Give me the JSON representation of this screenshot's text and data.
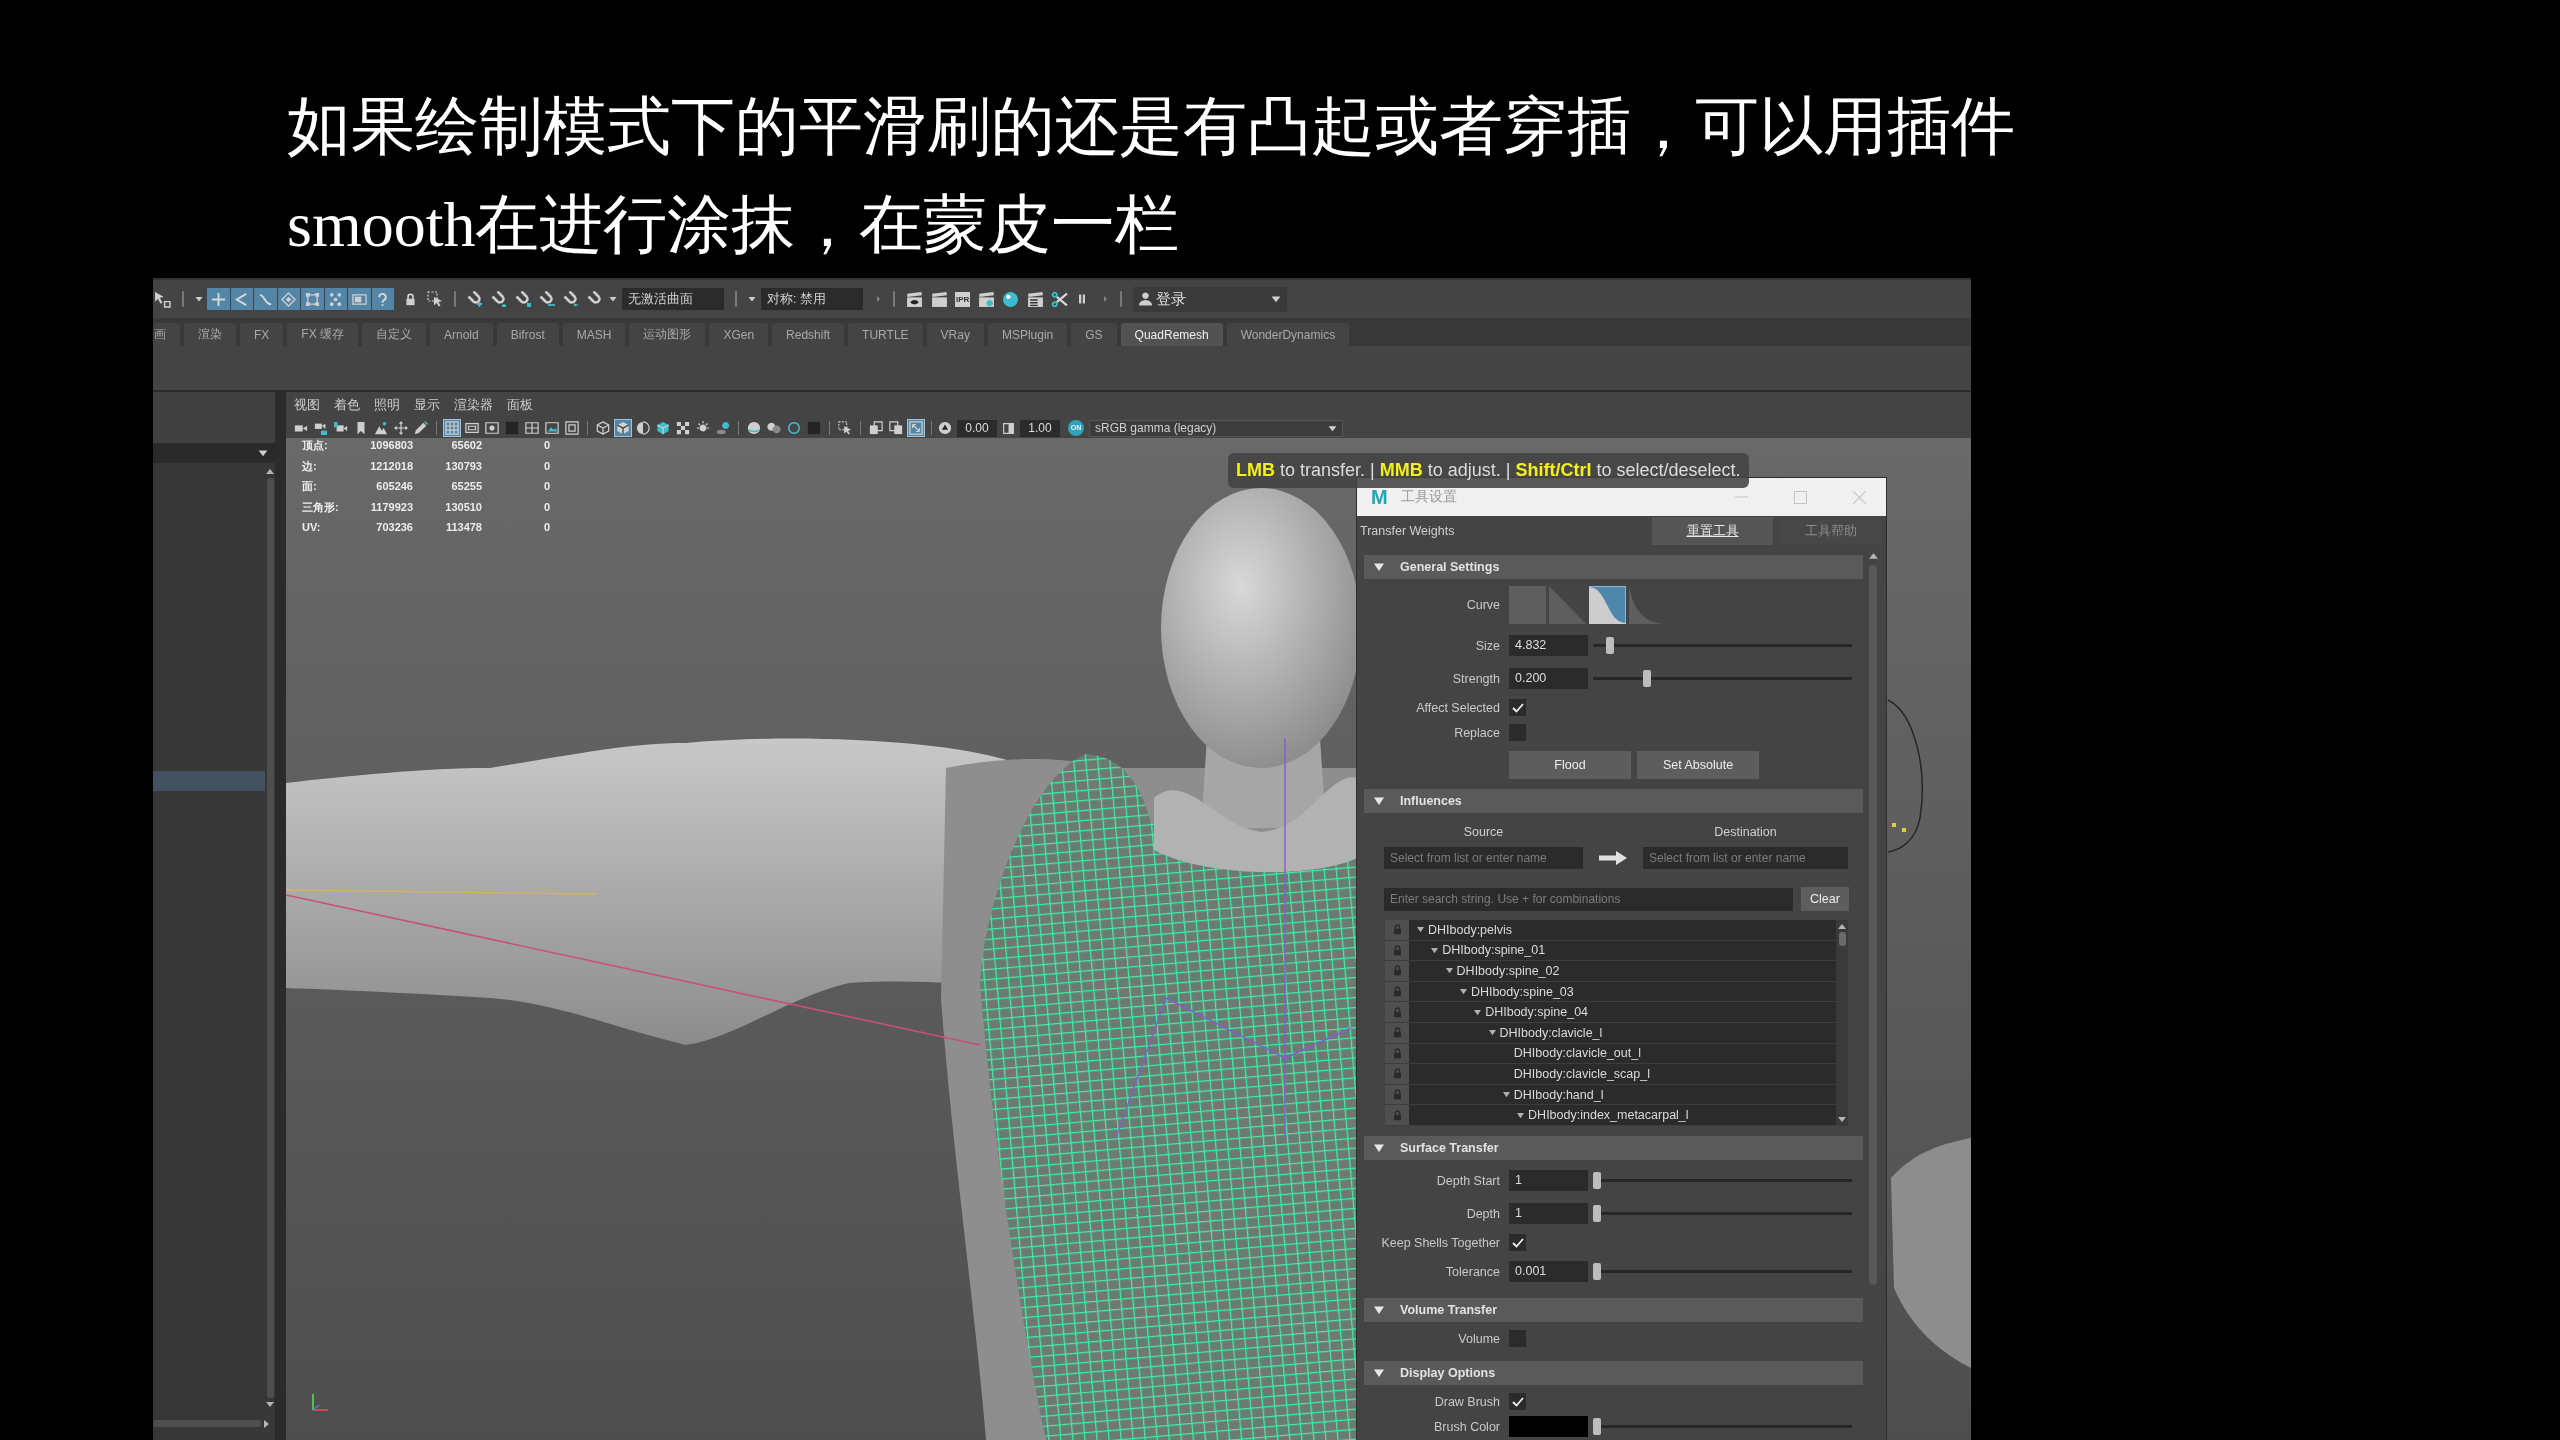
{
  "caption": {
    "lines": [
      "如果绘制模式下的平滑刷的还是有凸起或者穿插，可以用插件",
      "smooth在进行涂抹，在蒙皮一栏"
    ]
  },
  "status_line": {
    "mask_buttons": [
      {
        "on": true
      },
      {
        "on": true
      },
      {
        "on": true
      },
      {
        "on": true
      },
      {
        "on": true
      },
      {
        "on": true
      },
      {
        "on": true
      },
      {
        "on": true
      }
    ],
    "live_surface_field": "无激活曲面",
    "symmetry_field": "对称: 禁用",
    "ipr_label": "IPR",
    "login_label": "登录"
  },
  "shelf_tabs": [
    {
      "label": "画",
      "selected": false
    },
    {
      "label": "渲染",
      "selected": false
    },
    {
      "label": "FX",
      "selected": false
    },
    {
      "label": "FX 缓存",
      "selected": false
    },
    {
      "label": "自定义",
      "selected": false
    },
    {
      "label": "Arnold",
      "selected": false
    },
    {
      "label": "Bifrost",
      "selected": false
    },
    {
      "label": "MASH",
      "selected": false
    },
    {
      "label": "运动图形",
      "selected": false
    },
    {
      "label": "XGen",
      "selected": false
    },
    {
      "label": "Redshift",
      "selected": false
    },
    {
      "label": "TURTLE",
      "selected": false
    },
    {
      "label": "VRay",
      "selected": false
    },
    {
      "label": "MSPlugin",
      "selected": false
    },
    {
      "label": "GS",
      "selected": false
    },
    {
      "label": "QuadRemesh",
      "selected": true
    },
    {
      "label": "WonderDynamics",
      "selected": false
    }
  ],
  "outliner": {
    "rows": [
      {
        "selected": false
      },
      {
        "selected": false
      },
      {
        "selected": false
      },
      {
        "selected": false
      },
      {
        "selected": false
      },
      {
        "selected": false
      },
      {
        "selected": false
      },
      {
        "selected": false
      },
      {
        "selected": false
      },
      {
        "selected": false
      },
      {
        "selected": false
      },
      {
        "selected": false
      },
      {
        "selected": false
      },
      {
        "selected": false
      },
      {
        "selected": false
      },
      {
        "selected": true
      }
    ]
  },
  "viewport": {
    "menu": [
      "视图",
      "着色",
      "照明",
      "显示",
      "渲染器",
      "面板"
    ],
    "view_buttons": [
      {
        "on": false
      },
      {
        "on": false
      },
      {
        "on": false
      },
      {
        "on": false
      },
      {
        "on": false
      },
      {
        "on": false
      },
      {
        "on": false
      },
      {
        "on": true
      },
      {
        "on": false
      },
      {
        "on": false
      },
      {
        "on": false
      },
      {
        "on": false
      },
      {
        "on": false
      },
      {
        "on": false
      },
      {
        "on": false
      },
      {
        "on": true
      },
      {
        "on": false
      },
      {
        "on": false
      },
      {
        "on": false
      },
      {
        "on": false
      },
      {
        "on": false
      },
      {
        "on": false
      },
      {
        "on": false
      },
      {
        "on": false
      },
      {
        "on": false
      },
      {
        "on": false
      },
      {
        "on": false
      },
      {
        "on": false
      },
      {
        "on": true
      }
    ],
    "exposure": "0.00",
    "gamma": "1.00",
    "color_management": {
      "label": "ON",
      "on": true
    },
    "color_space": "sRGB gamma (legacy)",
    "stats": [
      {
        "label": "顶点:",
        "values": [
          "1096803",
          "65602",
          "0"
        ]
      },
      {
        "label": "边:",
        "values": [
          "1212018",
          "130793",
          "0"
        ]
      },
      {
        "label": "面:",
        "values": [
          "605246",
          "65255",
          "0"
        ]
      },
      {
        "label": "三角形:",
        "values": [
          "1179923",
          "130510",
          "0"
        ]
      },
      {
        "label": "UV:",
        "values": [
          "703236",
          "113478",
          "0"
        ]
      }
    ],
    "hint": "**LMB** to transfer. | **MMB** to adjust. | **Shift/Ctrl** to select/deselect."
  },
  "tool_settings": {
    "app_logo": "M",
    "window_title": "工具设置",
    "tool_name": "Transfer Weights",
    "header_buttons": [
      {
        "label": "重置工具",
        "disabled": false
      },
      {
        "label": "工具帮助",
        "disabled": true
      }
    ],
    "sections": [
      {
        "title": "General Settings",
        "expanded": true,
        "rows": [
          {
            "kind": "curve",
            "label": "Curve",
            "presets": [
              {
                "kind": "flat",
                "selected": false
              },
              {
                "kind": "linear",
                "selected": false
              },
              {
                "kind": "smooth",
                "selected": true
              },
              {
                "kind": "falloff",
                "selected": false
              }
            ]
          },
          {
            "kind": "slider",
            "label": "Size",
            "value": "4.832",
            "level": 0.05
          },
          {
            "kind": "slider",
            "label": "Strength",
            "value": "0.200",
            "level": 0.2
          },
          {
            "kind": "checkbox",
            "label": "Affect Selected",
            "checked": true
          },
          {
            "kind": "checkbox",
            "label": "Replace",
            "checked": false
          },
          {
            "kind": "buttons",
            "buttons": [
              "Flood",
              "Set Absolute"
            ]
          }
        ]
      },
      {
        "title": "Influences",
        "expanded": true,
        "rows": [
          {
            "kind": "transfer",
            "source": {
              "label": "Source",
              "placeholder": "Select from list or enter name"
            },
            "destination": {
              "label": "Destination",
              "placeholder": "Select from list or enter name"
            }
          },
          {
            "kind": "search",
            "placeholder": "Enter search string. Use + for combinations",
            "button": "Clear"
          },
          {
            "kind": "tree",
            "items": [
              {
                "label": "DHIbody:pelvis",
                "expanded": true,
                "children": [
                  {
                    "label": "DHIbody:spine_01",
                    "expanded": true,
                    "children": [
                      {
                        "label": "DHIbody:spine_02",
                        "expanded": true,
                        "children": [
                          {
                            "label": "DHIbody:spine_03",
                            "expanded": true,
                            "children": [
                              {
                                "label": "DHIbody:spine_04",
                                "expanded": true,
                                "children": [
                                  {
                                    "label": "DHIbody:clavicle_l",
                                    "expanded": true,
                                    "children": [
                                      {
                                        "label": "DHIbody:clavicle_out_l"
                                      },
                                      {
                                        "label": "DHIbody:clavicle_scap_l"
                                      },
                                      {
                                        "label": "DHIbody:hand_l",
                                        "expanded": true,
                                        "children": [
                                          {
                                            "label": "DHIbody:index_metacarpal_l",
                                            "expanded": true
                                          }
                                        ]
                                      }
                                    ]
                                  }
                                ]
                              }
                            ]
                          }
                        ]
                      }
                    ]
                  }
                ]
              }
            ]
          }
        ]
      },
      {
        "title": "Surface Transfer",
        "expanded": true,
        "rows": [
          {
            "kind": "slider",
            "label": "Depth Start",
            "value": "1",
            "level": 0
          },
          {
            "kind": "slider",
            "label": "Depth",
            "value": "1",
            "level": 0
          },
          {
            "kind": "checkbox",
            "label": "Keep Shells Together",
            "checked": true
          },
          {
            "kind": "slider",
            "label": "Tolerance",
            "value": "0.001",
            "level": 0
          }
        ]
      },
      {
        "title": "Volume Transfer",
        "expanded": true,
        "rows": [
          {
            "kind": "checkbox",
            "label": "Volume",
            "checked": false
          }
        ]
      },
      {
        "title": "Display Options",
        "expanded": true,
        "rows": [
          {
            "kind": "checkbox",
            "label": "Draw Brush",
            "checked": true
          },
          {
            "kind": "color",
            "label": "Brush Color",
            "color": "#000000",
            "level": 0
          }
        ]
      }
    ]
  }
}
